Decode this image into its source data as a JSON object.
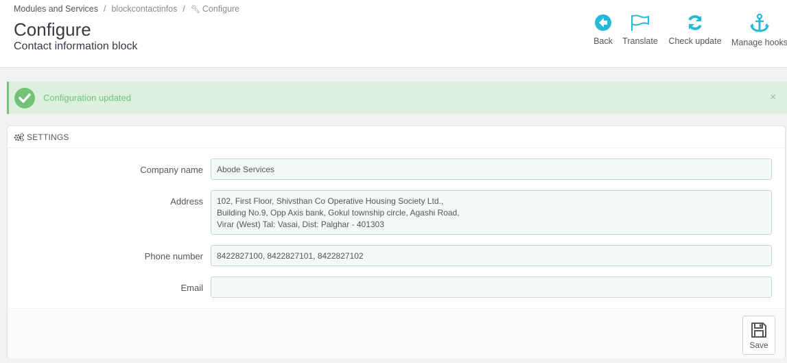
{
  "breadcrumb": {
    "items": [
      "Modules and Services",
      "blockcontactinfos",
      "Configure"
    ],
    "separator": "/"
  },
  "header": {
    "title": "Configure",
    "subtitle": "Contact information block"
  },
  "toolbar": {
    "back": "Back",
    "translate": "Translate",
    "check_update": "Check update",
    "manage_hooks": "Manage hooks"
  },
  "alert": {
    "message": "Configuration updated",
    "close": "×"
  },
  "panel": {
    "heading": "SETTINGS"
  },
  "form": {
    "company_label": "Company name",
    "company_value": "Abode Services",
    "address_label": "Address",
    "address_value": "102, First Floor, Shivsthan Co Operative Housing Society Ltd.,\nBuilding No.9, Opp Axis bank, Gokul township circle, Agashi Road,\nVirar (West) Tal: Vasai, Dist: Palghar - 401303",
    "phone_label": "Phone number",
    "phone_value": "8422827100, 8422827101, 8422827102",
    "email_label": "Email",
    "email_value": ""
  },
  "footer": {
    "save_label": "Save"
  },
  "colors": {
    "accent": "#25b9d7",
    "success": "#72c279",
    "success_bg": "#ddf0de"
  }
}
